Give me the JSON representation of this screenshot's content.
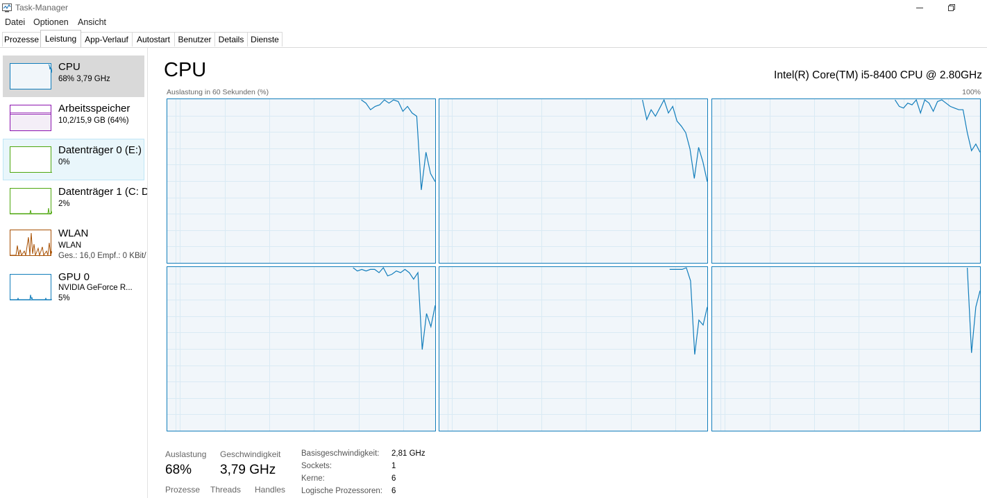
{
  "window": {
    "title": "Task-Manager",
    "icon": "task-manager-icon"
  },
  "menu": [
    "Datei",
    "Optionen",
    "Ansicht"
  ],
  "tabs": [
    {
      "label": "Prozesse"
    },
    {
      "label": "Leistung",
      "active": true
    },
    {
      "label": "App-Verlauf"
    },
    {
      "label": "Autostart"
    },
    {
      "label": "Benutzer"
    },
    {
      "label": "Details"
    },
    {
      "label": "Dienste"
    }
  ],
  "sidebar": [
    {
      "title": "CPU",
      "sub": "68% 3,79 GHz",
      "color": "#117dbb"
    },
    {
      "title": "Arbeitsspeicher",
      "sub": "10,2/15,9 GB (64%)",
      "color": "#8b12ae"
    },
    {
      "title": "Datenträger 0 (E:)",
      "sub": "0%",
      "color": "#4da60c"
    },
    {
      "title": "Datenträger 1 (C: D",
      "sub": "2%",
      "color": "#4da60c"
    },
    {
      "title": "WLAN",
      "sub": "WLAN",
      "sub2": "Ges.: 16,0 Empf.: 0 KBit/",
      "color": "#a74f01"
    },
    {
      "title": "GPU 0",
      "sub": "NVIDIA GeForce R...",
      "sub2": "5%",
      "color": "#117dbb"
    }
  ],
  "main": {
    "title": "CPU",
    "model": "Intel(R) Core(TM) i5-8400 CPU @ 2.80GHz",
    "graph_label": "Auslastung in 60 Sekunden (%)",
    "graph_max": "100%",
    "line_color": "#117dbb",
    "cores": [
      [
        null,
        null,
        null,
        null,
        null,
        null,
        null,
        null,
        null,
        null,
        null,
        null,
        null,
        null,
        null,
        null,
        null,
        null,
        null,
        null,
        null,
        null,
        null,
        null,
        null,
        null,
        null,
        null,
        null,
        null,
        null,
        null,
        null,
        null,
        null,
        null,
        null,
        null,
        null,
        null,
        null,
        null,
        100,
        98,
        94,
        96,
        97,
        100,
        98,
        100,
        99,
        93,
        96,
        92,
        90,
        45,
        68,
        55,
        50
      ],
      [
        null,
        null,
        null,
        null,
        null,
        null,
        null,
        null,
        null,
        null,
        null,
        null,
        null,
        null,
        null,
        null,
        null,
        null,
        null,
        null,
        null,
        null,
        null,
        null,
        null,
        null,
        null,
        null,
        null,
        null,
        null,
        null,
        null,
        null,
        null,
        null,
        null,
        null,
        null,
        null,
        null,
        null,
        null,
        null,
        null,
        null,
        null,
        100,
        88,
        94,
        90,
        95,
        100,
        92,
        96,
        87,
        84,
        80,
        70,
        52,
        71,
        62,
        50
      ],
      [
        null,
        null,
        null,
        null,
        null,
        null,
        null,
        null,
        null,
        null,
        null,
        null,
        null,
        null,
        null,
        null,
        null,
        null,
        null,
        null,
        null,
        null,
        null,
        null,
        null,
        null,
        null,
        null,
        null,
        null,
        null,
        null,
        null,
        null,
        null,
        null,
        null,
        null,
        null,
        null,
        null,
        null,
        null,
        100,
        96,
        95,
        98,
        97,
        100,
        92,
        100,
        98,
        93,
        99,
        100,
        98,
        96,
        95,
        94,
        94,
        80,
        69,
        73,
        68
      ],
      [
        null,
        null,
        null,
        null,
        null,
        null,
        null,
        null,
        null,
        null,
        null,
        null,
        null,
        null,
        null,
        null,
        null,
        null,
        null,
        null,
        null,
        null,
        null,
        null,
        null,
        null,
        null,
        null,
        null,
        null,
        null,
        null,
        null,
        null,
        null,
        null,
        null,
        null,
        null,
        null,
        null,
        null,
        null,
        100,
        98,
        99,
        98,
        99,
        99,
        97,
        100,
        95,
        96,
        98,
        97,
        99,
        97,
        93,
        97,
        50,
        72,
        64,
        77
      ],
      [
        null,
        null,
        null,
        null,
        null,
        null,
        null,
        null,
        null,
        null,
        null,
        null,
        null,
        null,
        null,
        null,
        null,
        null,
        null,
        null,
        null,
        null,
        null,
        null,
        null,
        null,
        null,
        null,
        null,
        null,
        null,
        null,
        null,
        null,
        null,
        null,
        null,
        null,
        null,
        null,
        null,
        null,
        null,
        null,
        null,
        null,
        null,
        null,
        null,
        null,
        null,
        null,
        null,
        null,
        null,
        99,
        99,
        99,
        99,
        100,
        92,
        47,
        68,
        65,
        76
      ],
      [
        null,
        null,
        null,
        null,
        null,
        null,
        null,
        null,
        null,
        null,
        null,
        null,
        null,
        null,
        null,
        null,
        null,
        null,
        null,
        null,
        null,
        null,
        null,
        null,
        null,
        null,
        null,
        null,
        null,
        null,
        null,
        null,
        null,
        null,
        null,
        null,
        null,
        null,
        null,
        null,
        null,
        null,
        null,
        null,
        null,
        null,
        null,
        null,
        null,
        null,
        null,
        null,
        null,
        null,
        null,
        null,
        null,
        null,
        null,
        null,
        100,
        48,
        76,
        86
      ]
    ]
  },
  "stats": {
    "util_label": "Auslastung",
    "util_value": "68%",
    "speed_label": "Geschwindigkeit",
    "speed_value": "3,79 GHz",
    "proc_label": "Prozesse",
    "threads_label": "Threads",
    "handles_label": "Handles",
    "kv": [
      {
        "label": "Basisgeschwindigkeit:",
        "value": "2,81 GHz"
      },
      {
        "label": "Sockets:",
        "value": "1"
      },
      {
        "label": "Kerne:",
        "value": "6"
      },
      {
        "label": "Logische Prozessoren:",
        "value": "6"
      }
    ]
  }
}
